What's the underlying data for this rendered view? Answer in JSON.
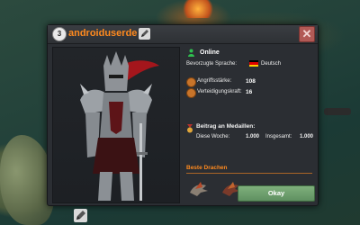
{
  "player": {
    "level": "3",
    "username": "androiduserde"
  },
  "status": {
    "online_label": "Online"
  },
  "language": {
    "label": "Bevorzugte Sprache:",
    "value": "Deutsch",
    "flag_colors": [
      "#000000",
      "#dd0000",
      "#ffce00"
    ]
  },
  "stats": {
    "attack_label": "Angriffsstärke:",
    "attack_value": "108",
    "defense_label": "Verteidigungskraft:",
    "defense_value": "16"
  },
  "medals": {
    "title": "Beitrag an Medaillen:",
    "week_label": "Diese Woche:",
    "week_value": "1.000",
    "total_label": "Insgesamt:",
    "total_value": "1.000"
  },
  "dragons": {
    "title": "Beste Drachen",
    "icons": [
      "dragon-icon",
      "dragon-icon"
    ]
  },
  "buttons": {
    "close_symbol": "✕",
    "okay_label": "Okay"
  },
  "colors": {
    "accent_orange": "#ff8a1e",
    "okay_green": "#6e9f6d",
    "close_red": "#b25a56",
    "panel_bg": "#2b2e33",
    "online_green": "#2fbf4f"
  }
}
